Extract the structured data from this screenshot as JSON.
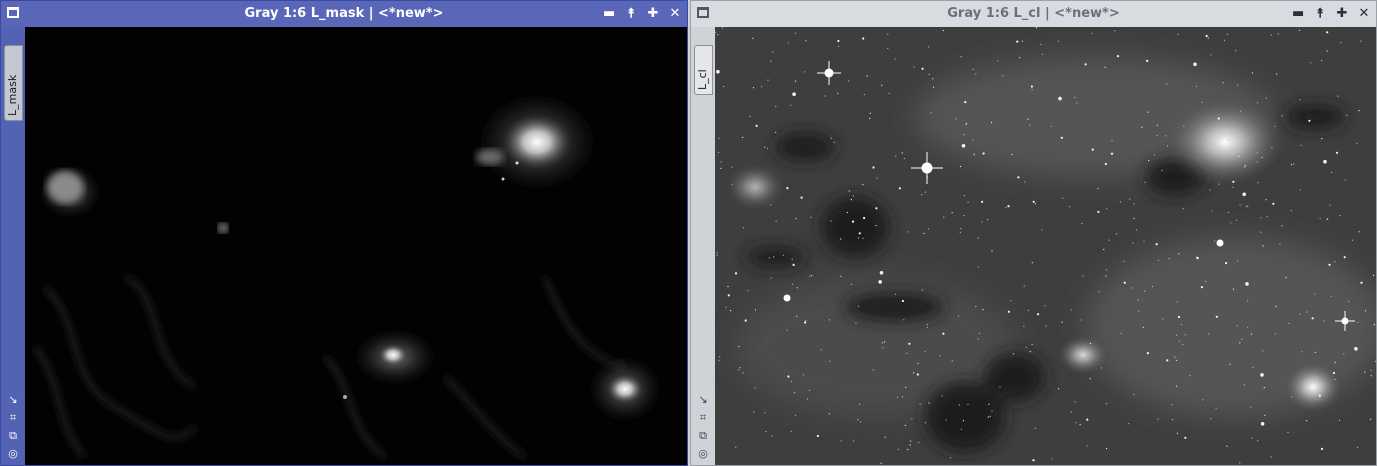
{
  "windows": [
    {
      "title": "Gray 1:6 L_mask | <*new*>",
      "tab_label": "L_mask",
      "controls": {
        "minimize": "▬",
        "shade": "⯭",
        "maximize": "✚",
        "close": "✕"
      }
    },
    {
      "title": "Gray 1:6 L_cl | <*new*>",
      "tab_label": "L_cl",
      "controls": {
        "minimize": "▬",
        "shade": "⯭",
        "maximize": "✚",
        "close": "✕"
      }
    }
  ],
  "side_icons": [
    "↘",
    "⌗",
    "⧉",
    "◎"
  ],
  "colors": {
    "active_titlebar": "#5a66b8",
    "inactive_titlebar": "#d8dbe0"
  }
}
